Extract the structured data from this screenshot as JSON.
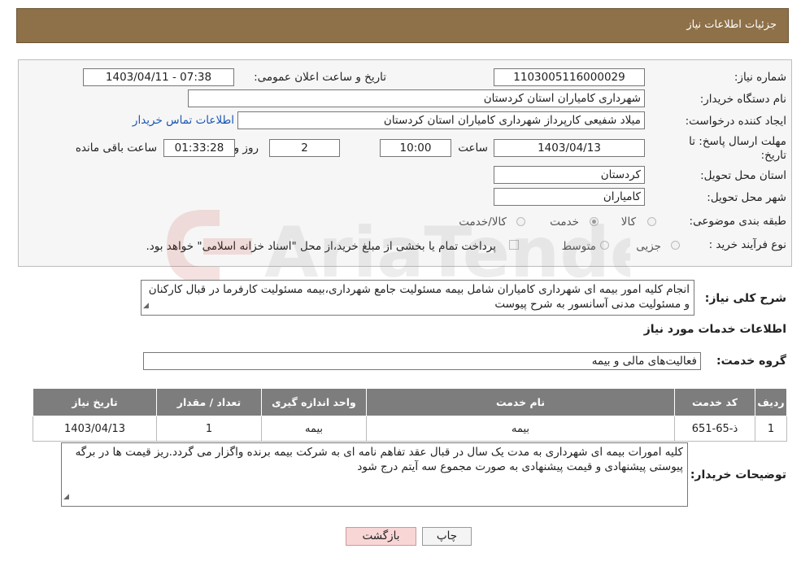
{
  "header": {
    "title": "جزئیات اطلاعات نیاز"
  },
  "form": {
    "need_number": {
      "label": "شماره نیاز:",
      "value": "1103005116000029"
    },
    "announce_datetime": {
      "label": "تاریخ و ساعت اعلان عمومی:",
      "value": "1403/04/11 - 07:38"
    },
    "buyer_org": {
      "label": "نام دستگاه خریدار:",
      "value": "شهرداری کامیاران استان کردستان"
    },
    "creator": {
      "label": "ایجاد کننده درخواست:",
      "value": "میلاد شفیعی کارپرداز شهرداری کامیاران استان کردستان",
      "contact_link": "اطلاعات تماس خریدار"
    },
    "deadline": {
      "label_line1": "مهلت ارسال پاسخ: تا",
      "label_line2": "تاریخ:",
      "date": "1403/04/13",
      "time_label": "ساعت",
      "time": "10:00",
      "days": "2",
      "days_label": "روز و",
      "remaining": "01:33:28",
      "remaining_label": "ساعت باقی مانده"
    },
    "province": {
      "label": "استان محل تحویل:",
      "value": "کردستان"
    },
    "city": {
      "label": "شهر محل تحویل:",
      "value": "کامیاران"
    },
    "category": {
      "label": "طبقه بندی موضوعی:",
      "options": [
        "کالا",
        "خدمت",
        "کالا/خدمت"
      ],
      "selected": "خدمت"
    },
    "purchase_type": {
      "label": "نوع فرآیند خرید :",
      "options": [
        "جزیی",
        "متوسط"
      ],
      "note": "پرداخت تمام یا بخشی از مبلغ خرید،از محل \"اسناد خزانه اسلامی\" خواهد بود."
    },
    "description": {
      "label": "شرح کلی نیاز:",
      "value": "انجام کلیه امور بیمه ای شهرداری کامیاران شامل بیمه مسئولیت جامع شهرداری،بیمه مسئولیت کارفرما در قبال کارکنان و مسئولیت مدنی آسانسور به شرح پیوست"
    }
  },
  "services": {
    "section_title": "اطلاعات خدمات مورد نیاز",
    "group_label": "گروه خدمت:",
    "group_value": "فعالیت‌های مالی و بیمه",
    "table": {
      "headers": [
        "ردیف",
        "کد خدمت",
        "نام خدمت",
        "واحد اندازه گیری",
        "تعداد / مقدار",
        "تاریخ نیاز"
      ],
      "rows": [
        [
          "1",
          "ذ-65-651",
          "بیمه",
          "بیمه",
          "1",
          "1403/04/13"
        ]
      ]
    }
  },
  "buyer_notes": {
    "label": "توضیحات خریدار:",
    "value": "کلیه امورات بیمه ای شهرداری به مدت یک سال در قبال عقد تفاهم نامه ای به شرکت بیمه برنده واگزار می گردد.ریز قیمت ها در برگه پیوستی پیشنهادی و قیمت پیشنهادی به صورت مجموع سه آیتم درج شود"
  },
  "buttons": {
    "print": "چاپ",
    "back": "بازگشت"
  },
  "watermark": {
    "text": "AriaTender.neT"
  }
}
